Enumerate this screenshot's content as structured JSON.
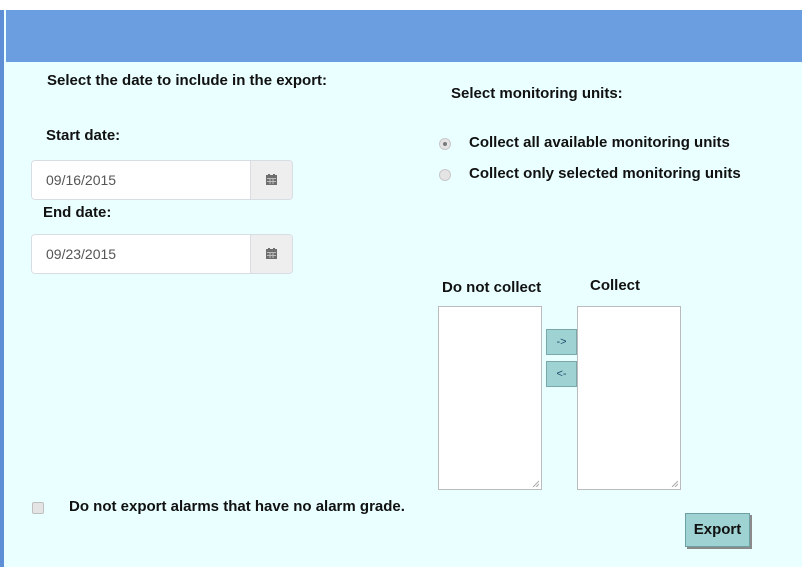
{
  "export_dates": {
    "heading": "Select the date to include in the export:",
    "start_label": "Start date:",
    "start_value": "09/16/2015",
    "end_label": "End date:",
    "end_value": "09/23/2015",
    "calendar_icon": "calendar-icon"
  },
  "monitoring": {
    "heading": "Select monitoring units:",
    "options": [
      {
        "label": "Collect all available monitoring units",
        "selected": true
      },
      {
        "label": "Collect only selected monitoring units",
        "selected": false
      }
    ]
  },
  "lists": {
    "do_not_collect_label": "Do not collect",
    "collect_label": "Collect",
    "move_right_label": "->",
    "move_left_label": "<-"
  },
  "alarms_option": {
    "label": "Do not export alarms that have no alarm grade.",
    "checked": false
  },
  "export_button": "Export",
  "colors": {
    "header_bar": "#6a9ee0",
    "panel_background": "#eaffff",
    "button_fill": "#9fd3d3"
  }
}
